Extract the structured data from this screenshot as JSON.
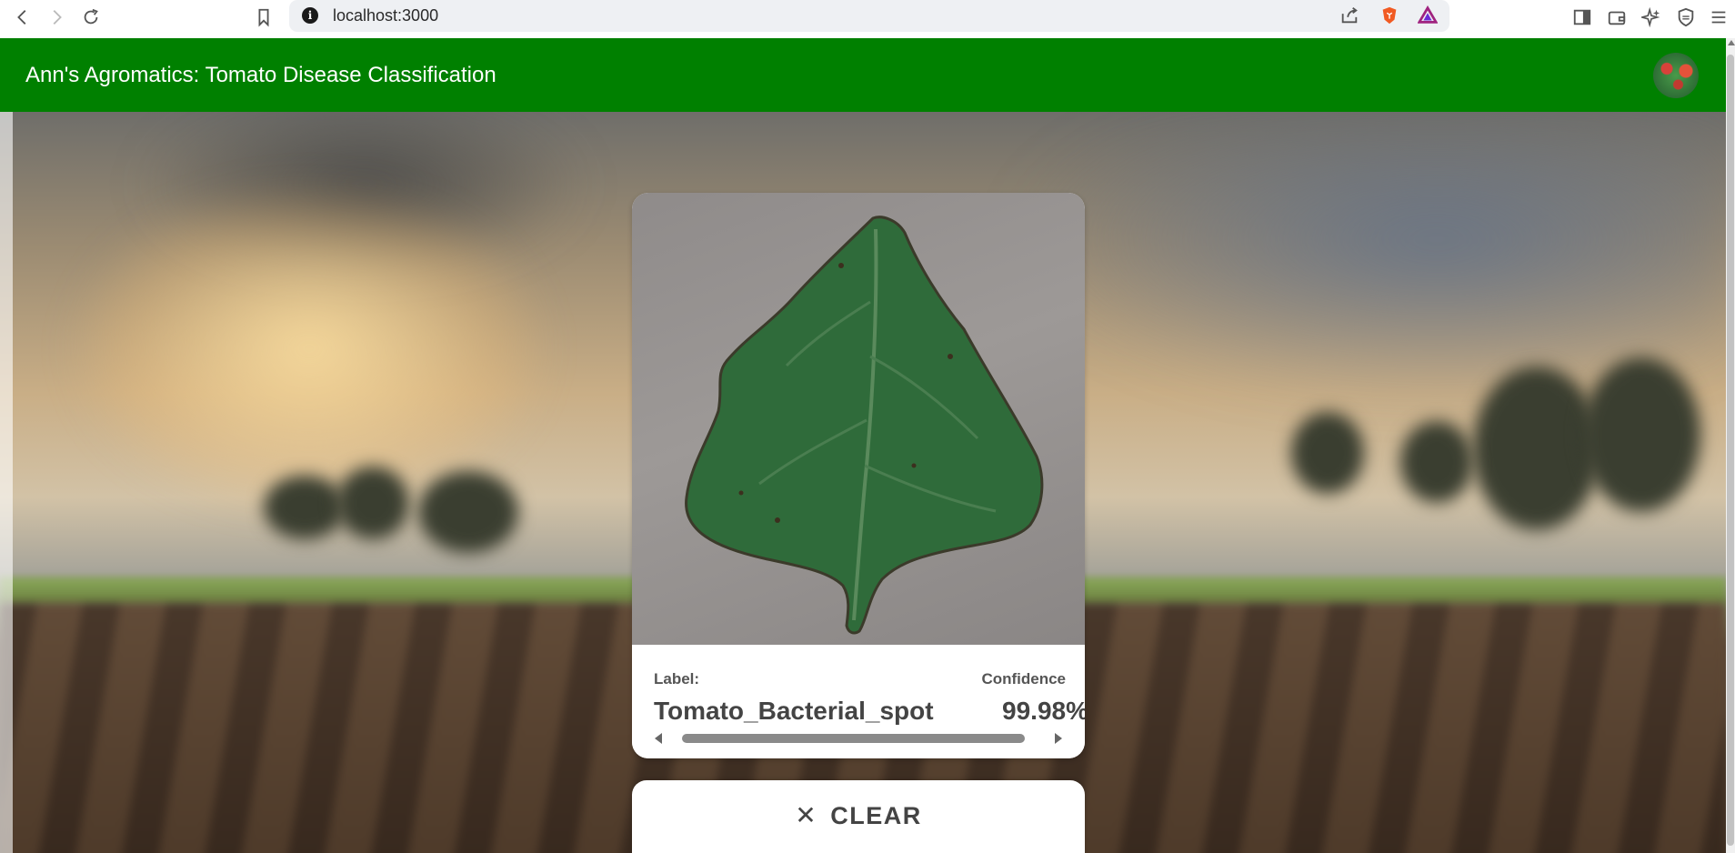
{
  "browser": {
    "url": "localhost:3000",
    "icons": [
      "back-icon",
      "forward-icon",
      "reload-icon",
      "bookmark-icon",
      "site-info-icon",
      "share-icon",
      "brave-shield-icon",
      "brave-rewards-icon",
      "sidebar-icon",
      "wallet-icon",
      "leo-ai-icon",
      "vpn-icon",
      "menu-icon"
    ]
  },
  "app": {
    "title": "Ann's Agromatics: Tomato Disease Classification",
    "header_color": "#008000"
  },
  "result": {
    "label_heading": "Label:",
    "confidence_heading": "Confidence",
    "label_value": "Tomato_Bacterial_spot",
    "confidence_value": "99.98%",
    "scroll_position": 0
  },
  "actions": {
    "clear_label": "CLEAR"
  }
}
